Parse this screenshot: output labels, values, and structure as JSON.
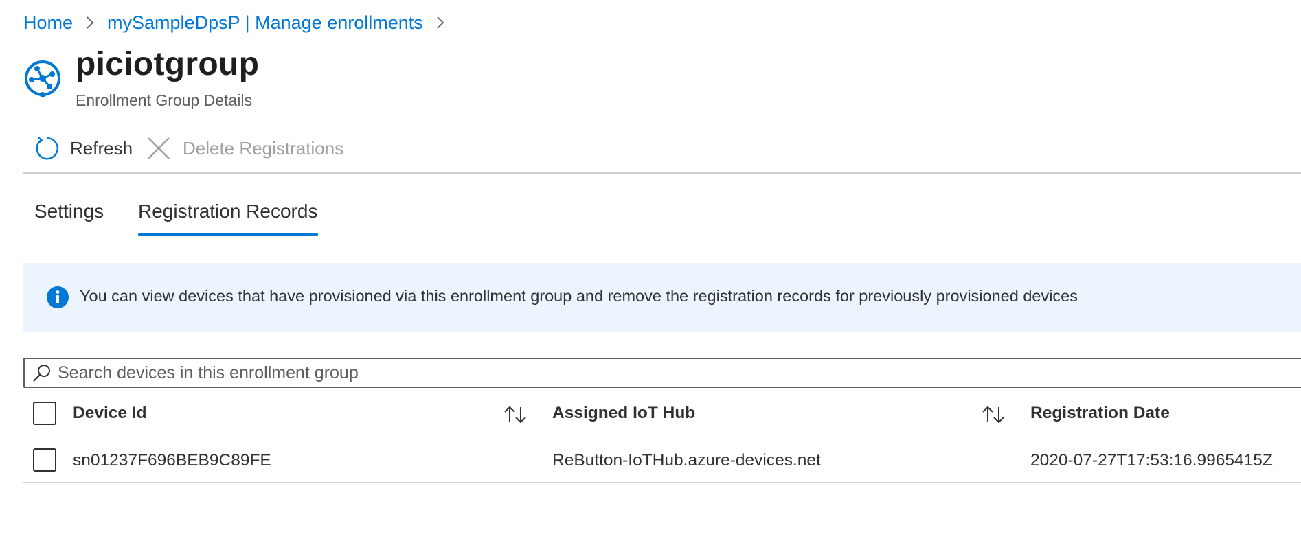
{
  "breadcrumb": {
    "items": [
      {
        "label": "Home"
      },
      {
        "label": "mySampleDpsP | Manage enrollments"
      }
    ]
  },
  "header": {
    "title": "piciotgroup",
    "subtitle": "Enrollment Group Details",
    "icon": "iot-hub-icon"
  },
  "toolbar": {
    "refresh_label": "Refresh",
    "delete_label": "Delete Registrations"
  },
  "tabs": [
    {
      "label": "Settings",
      "selected": false
    },
    {
      "label": "Registration Records",
      "selected": true
    }
  ],
  "info": {
    "text": "You can view devices that have provisioned via this enrollment group  and remove the registration records for previously provisioned devices"
  },
  "search": {
    "placeholder": "Search devices in this enrollment group",
    "value": ""
  },
  "table": {
    "columns": [
      {
        "label": "Device Id",
        "sortable": true
      },
      {
        "label": "Assigned IoT Hub",
        "sortable": true
      },
      {
        "label": "Registration Date",
        "sortable": false
      }
    ],
    "rows": [
      {
        "device_id": "sn01237F696BEB9C89FE",
        "assigned_hub": "ReButton-IoTHub.azure-devices.net",
        "registration_date": "2020-07-27T17:53:16.9965415Z"
      }
    ]
  },
  "colors": {
    "accent": "#0078d4",
    "info_background": "#ecf4fd",
    "disabled_text": "#a19f9d"
  }
}
